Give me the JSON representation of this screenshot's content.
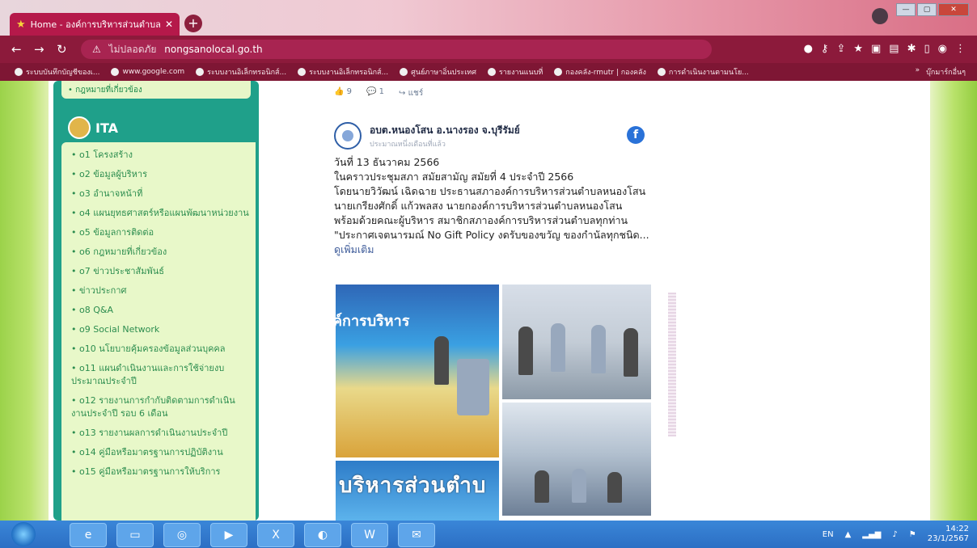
{
  "browser": {
    "tab_title": "Home - องค์การบริหารส่วนตำบลหน...",
    "url_warning": "ไม่ปลอดภัย",
    "url": "nongsanolocal.go.th",
    "bookmarks": [
      "ระบบบันทึกบัญชีของเ...",
      "www.google.com",
      "ระบบงานอิเล็กทรอนิกส์...",
      "ระบบงานอิเล็กทรอนิกส์...",
      "ศูนย์ภาษาอิ่นประเทศ",
      "รายงานแนบที่",
      "กองคลัง-rmutr | กองคลัง",
      "การดำเนินงานตามนโย..."
    ],
    "bookmarks_other": "บุ๊กมาร์กอื่นๆ"
  },
  "sidebar": {
    "top_item": "• กฎหมายที่เกี่ยวข้อง",
    "header": "ITA",
    "items": [
      "o1 โครงสร้าง",
      "o2 ข้อมูลผู้บริหาร",
      "o3 อำนาจหน้าที่",
      "o4 แผนยุทธศาสตร์หรือแผนพัฒนาหน่วยงาน",
      "o5 ข้อมูลการติดต่อ",
      "o6 กฎหมายที่เกี่ยวข้อง",
      "o7 ข่าวประชาสัมพันธ์",
      "ข่าวประกาศ",
      "o8 Q&A",
      "o9 Social Network",
      "o10 นโยบายคุ้มครองข้อมูลส่วนบุคคล",
      "o11 แผนดำเนินงานและการใช้จ่ายงบประมาณประจำปี",
      "o12 รายงานการกำกับติดตามการดำเนินงานประจำปี รอบ 6 เดือน",
      "o13 รายงานผลการดำเนินงานประจำปี",
      "o14 คู่มือหรือมาตรฐานการปฏิบัติงาน",
      "o15 คู่มือหรือมาตรฐานการให้บริการ"
    ]
  },
  "feed": {
    "likes": "9",
    "comments": "1",
    "share": "แชร์",
    "page_name": "อบต.หนองโสน อ.นางรอง จ.บุรีรัมย์",
    "post_time": "ประมาณหนึ่งเดือนที่แล้ว",
    "post_lines": [
      "วันที่ 13 ธันวาคม 2566",
      "ในคราวประชุมสภา สมัยสามัญ สมัยที่ 4 ประจำปี 2566",
      "โดยนายวิวัฒน์ เฉิดฉาย ประธานสภาองค์การบริหารส่วนตำบลหนองโสน",
      "นายเกรียงศักดิ์ แก้วพลสง นายกองค์การบริหารส่วนตำบลหนองโสน",
      "พร้อมด้วยคณะผู้บริหาร สมาชิกสภาองค์การบริหารส่วนตำบลทุกท่าน",
      "\"ประกาศเจตนารมณ์ No Gift Policy งดรับของขวัญ ของกำนัลทุกชนิด..."
    ],
    "see_more": "ดูเพิ่มเติม",
    "photo_banner_1": "ค์การบริหาร",
    "photo_banner_2": "บริหารส่วนตำบ"
  },
  "taskbar": {
    "lang": "EN",
    "time": "14:22",
    "date": "23/1/2567"
  }
}
